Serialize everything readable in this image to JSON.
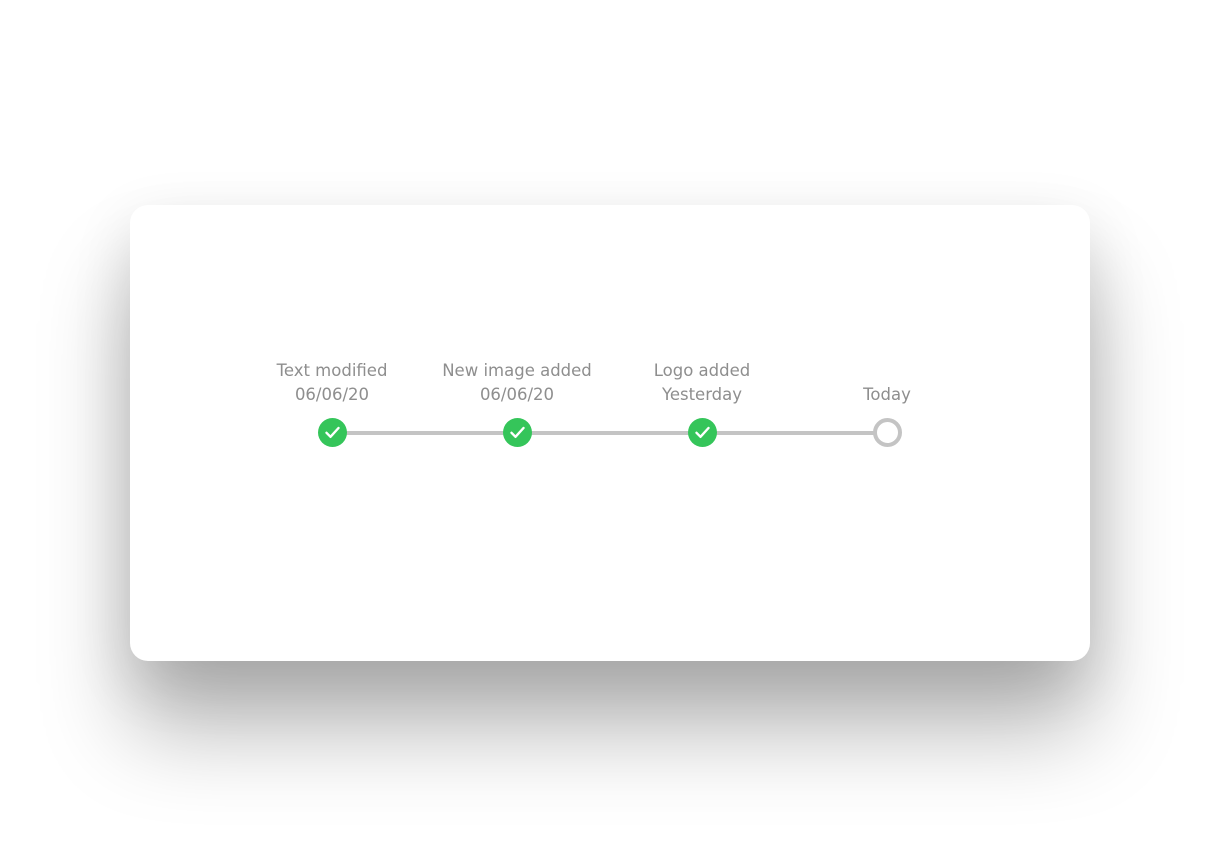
{
  "timeline": {
    "steps": [
      {
        "title": "Text modified",
        "subtitle": "06/06/20",
        "status": "done",
        "icon": "check-icon"
      },
      {
        "title": "New image added",
        "subtitle": "06/06/20",
        "status": "done",
        "icon": "check-icon"
      },
      {
        "title": "Logo added",
        "subtitle": "Yesterday",
        "status": "done",
        "icon": "check-icon"
      },
      {
        "title": "",
        "subtitle": "Today",
        "status": "pending",
        "icon": "empty-circle-icon"
      }
    ],
    "colors": {
      "complete": "#35c55a",
      "track": "#c4c4c4",
      "text": "#8e8e8e"
    }
  }
}
